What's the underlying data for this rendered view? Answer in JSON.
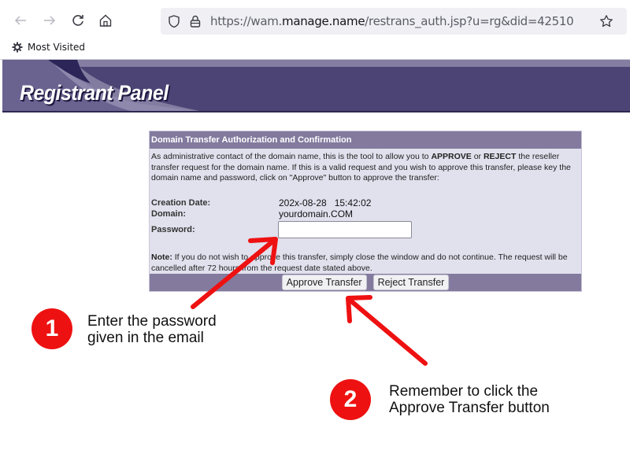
{
  "browser": {
    "url_prefix": "https://wam.",
    "url_host": "manage.name",
    "url_path": "/restrans_auth.jsp?u=rg&did=42510",
    "bookmarks": [
      {
        "label": "Most Visited",
        "icon": "gear-icon"
      }
    ]
  },
  "banner": {
    "title": "Registrant Panel",
    "colors": {
      "dark": "#4b4474",
      "light": "#857ea2"
    }
  },
  "panel": {
    "header": "Domain Transfer Authorization and Confirmation",
    "intro_pre": "As administrative contact of the domain name, this is the tool to allow you to ",
    "intro_approve": "APPROVE",
    "intro_or": " or ",
    "intro_reject": "REJECT",
    "intro_post": " the reseller transfer request for the domain name. If this is a valid request and you wish to approve this transfer, please key the domain name and password, click on \"Approve\" button to approve the transfer:",
    "fields": {
      "creation_date_label": "Creation Date:",
      "creation_date_value": "202x-08-28   15:42:02",
      "domain_label": "Domain:",
      "domain_value": "yourdomain.COM",
      "password_label": "Password:",
      "password_value": ""
    },
    "note_label": "Note:",
    "note_text": " If you do not wish to approve this transfer, simply close the window and do not continue. The request will be cancelled after 72 hours from the request date stated above.",
    "buttons": {
      "approve": "Approve Transfer",
      "reject": "Reject Transfer"
    }
  },
  "annotations": [
    {
      "number": "1",
      "line1": "Enter the password",
      "line2": "given in the email"
    },
    {
      "number": "2",
      "line1": "Remember to click the",
      "line2": "Approve Transfer button"
    }
  ],
  "colors": {
    "annotation_red": "#ee1111",
    "panel_header": "#837a9e",
    "panel_bg": "#e1e0ed"
  }
}
